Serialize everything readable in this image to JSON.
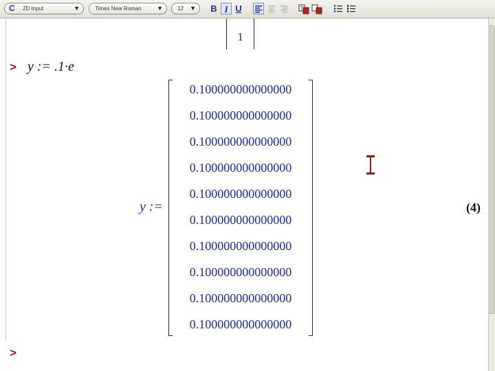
{
  "toolbar": {
    "mode_icon": "C",
    "mode": "2D Input",
    "font": "Times New Roman",
    "size": "12",
    "bold": "B",
    "italic": "I",
    "underline": "U",
    "icons": [
      "align-left-icon",
      "align-center-icon",
      "align-right-icon",
      "text-color-icon",
      "highlight-color-icon",
      "bullet-list-icon",
      "numbered-list-icon"
    ]
  },
  "worksheet": {
    "previous_output_value": "1",
    "prompt_symbol": ">",
    "input": "y := .1·e",
    "output_lhs": "y :=",
    "matrix_values": [
      "0.100000000000000",
      "0.100000000000000",
      "0.100000000000000",
      "0.100000000000000",
      "0.100000000000000",
      "0.100000000000000",
      "0.100000000000000",
      "0.100000000000000",
      "0.100000000000000",
      "0.100000000000000"
    ],
    "equation_label": "(4)",
    "colors": {
      "prompt": "#b01616",
      "output": "#1a2b9a"
    }
  }
}
